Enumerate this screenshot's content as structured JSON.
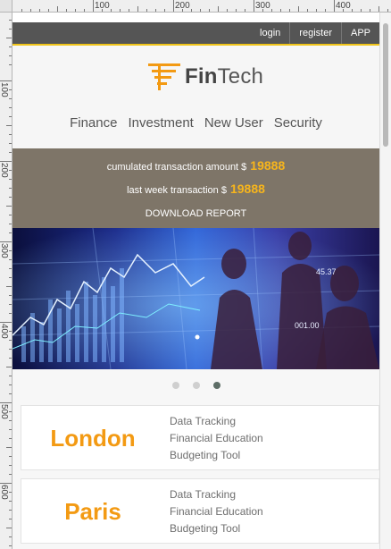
{
  "ruler": {
    "x_labels": [
      "100",
      "200",
      "300",
      "400"
    ],
    "y_labels": [
      "100",
      "200",
      "300",
      "400",
      "500",
      "600"
    ]
  },
  "topbar": {
    "links": [
      "login",
      "register",
      "APP"
    ]
  },
  "logo": {
    "text_bold": "Fin",
    "text_regular": "Tech",
    "accent_color": "#f39a13"
  },
  "nav": {
    "items": [
      "Finance",
      "Investment",
      "New User",
      "Security"
    ]
  },
  "stats": {
    "cumulated_label": "cumulated transaction amount $",
    "cumulated_value": "19888",
    "lastweek_label": "last week transaction $",
    "lastweek_value": "19888",
    "download_label": "DOWNLOAD REPORT"
  },
  "banner": {
    "ticker_1": "45.37",
    "ticker_2": "001.00"
  },
  "carousel": {
    "dot_count": 3,
    "active_index": 2
  },
  "cards": [
    {
      "city": "London",
      "features": [
        "Data Tracking",
        "Financial Education",
        "Budgeting Tool"
      ]
    },
    {
      "city": "Paris",
      "features": [
        "Data Tracking",
        "Financial Education",
        "Budgeting Tool"
      ]
    }
  ]
}
